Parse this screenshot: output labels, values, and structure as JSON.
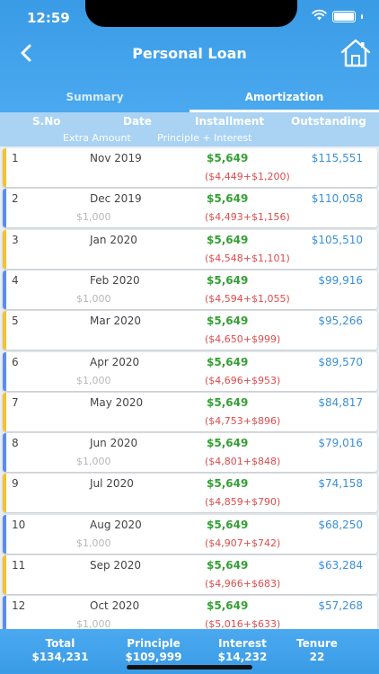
{
  "status": {
    "time": "12:59"
  },
  "header": {
    "title": "Personal Loan"
  },
  "tabs": [
    {
      "label": "Summary",
      "active": false
    },
    {
      "label": "Amortization",
      "active": true
    }
  ],
  "columns": {
    "sno": "S.No",
    "date": "Date",
    "installment": "Installment",
    "outstanding": "Outstanding",
    "extra_amount": "Extra Amount",
    "principle_interest": "Principle + Interest"
  },
  "rows": [
    {
      "sno": "1",
      "date": "Nov 2019",
      "installment": "$5,649",
      "breakdown": "($4,449+$1,200)",
      "outstanding": "$115,551",
      "extra": "",
      "bar_color": "#f5c12e"
    },
    {
      "sno": "2",
      "date": "Dec 2019",
      "installment": "$5,649",
      "breakdown": "($4,493+$1,156)",
      "outstanding": "$110,058",
      "extra": "$1,000",
      "bar_color": "#5b8def"
    },
    {
      "sno": "3",
      "date": "Jan 2020",
      "installment": "$5,649",
      "breakdown": "($4,548+$1,101)",
      "outstanding": "$105,510",
      "extra": "",
      "bar_color": "#f5c12e"
    },
    {
      "sno": "4",
      "date": "Feb 2020",
      "installment": "$5,649",
      "breakdown": "($4,594+$1,055)",
      "outstanding": "$99,916",
      "extra": "$1,000",
      "bar_color": "#5b8def"
    },
    {
      "sno": "5",
      "date": "Mar 2020",
      "installment": "$5,649",
      "breakdown": "($4,650+$999)",
      "outstanding": "$95,266",
      "extra": "",
      "bar_color": "#f5c12e"
    },
    {
      "sno": "6",
      "date": "Apr 2020",
      "installment": "$5,649",
      "breakdown": "($4,696+$953)",
      "outstanding": "$89,570",
      "extra": "$1,000",
      "bar_color": "#5b8def"
    },
    {
      "sno": "7",
      "date": "May 2020",
      "installment": "$5,649",
      "breakdown": "($4,753+$896)",
      "outstanding": "$84,817",
      "extra": "",
      "bar_color": "#f5c12e"
    },
    {
      "sno": "8",
      "date": "Jun 2020",
      "installment": "$5,649",
      "breakdown": "($4,801+$848)",
      "outstanding": "$79,016",
      "extra": "$1,000",
      "bar_color": "#5b8def"
    },
    {
      "sno": "9",
      "date": "Jul 2020",
      "installment": "$5,649",
      "breakdown": "($4,859+$790)",
      "outstanding": "$74,158",
      "extra": "",
      "bar_color": "#f5c12e"
    },
    {
      "sno": "10",
      "date": "Aug 2020",
      "installment": "$5,649",
      "breakdown": "($4,907+$742)",
      "outstanding": "$68,250",
      "extra": "$1,000",
      "bar_color": "#5b8def"
    },
    {
      "sno": "11",
      "date": "Sep 2020",
      "installment": "$5,649",
      "breakdown": "($4,966+$683)",
      "outstanding": "$63,284",
      "extra": "",
      "bar_color": "#f5c12e"
    },
    {
      "sno": "12",
      "date": "Oct 2020",
      "installment": "$5,649",
      "breakdown": "($5,016+$633)",
      "outstanding": "$57,268",
      "extra": "$1,000",
      "bar_color": "#5b8def"
    }
  ],
  "footer": {
    "total_label": "Total",
    "total_value": "$134,231",
    "principle_label": "Principle",
    "principle_value": "$109,999",
    "interest_label": "Interest",
    "interest_value": "$14,232",
    "tenure_label": "Tenure",
    "tenure_value": "22"
  },
  "icons": {
    "back": "back-arrow-icon",
    "home": "home-icon",
    "wifi": "wifi-icon",
    "battery": "battery-icon"
  }
}
